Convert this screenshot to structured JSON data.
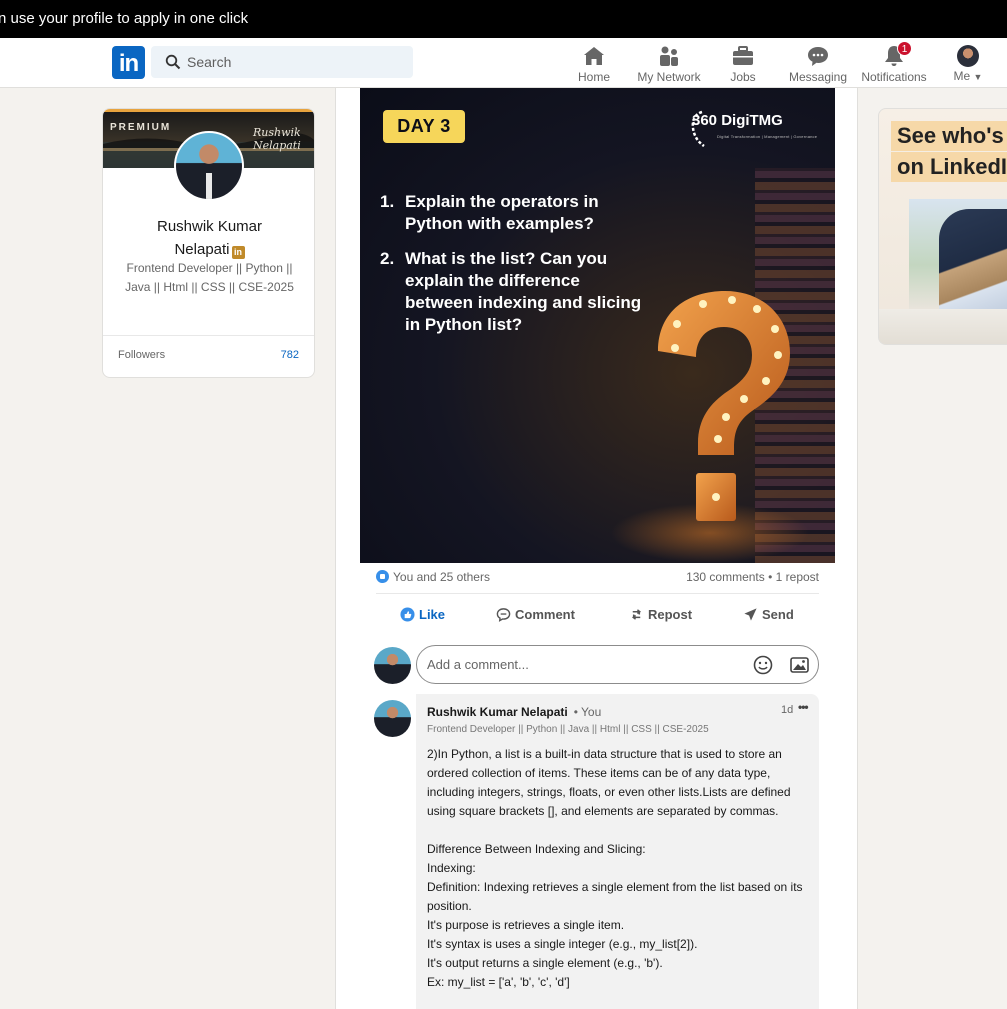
{
  "banner": {
    "text": "n use your profile to apply in one click"
  },
  "nav": {
    "logo": "in",
    "search_placeholder": "Search",
    "items": [
      {
        "label": "Home",
        "icon": "home-icon"
      },
      {
        "label": "My Network",
        "icon": "network-icon"
      },
      {
        "label": "Jobs",
        "icon": "jobs-icon"
      },
      {
        "label": "Messaging",
        "icon": "messaging-icon"
      },
      {
        "label": "Notifications",
        "icon": "bell-icon",
        "badge": "1"
      },
      {
        "label": "Me",
        "icon": "avatar"
      }
    ]
  },
  "profile": {
    "premium": "PREMIUM",
    "cover_signature": "Rushwik Nelapati",
    "name_line1": "Rushwik Kumar",
    "name_line2": "Nelapati",
    "headline": "Frontend Developer || Python || Java || Html || CSS || CSE-2025",
    "followers_label": "Followers",
    "followers_count": "782"
  },
  "post": {
    "image": {
      "day": "DAY 3",
      "brand": "360 DigiTMG",
      "brand_sub": "Digital Transformation | Management | Governance",
      "questions": [
        {
          "num": "1.",
          "text": "Explain the operators in Python with examples?"
        },
        {
          "num": "2.",
          "text": "What is the list? Can you explain the difference between indexing and slicing in Python list?"
        }
      ]
    },
    "reactions_text": "You and 25 others",
    "stats_text": "130 comments • 1 repost",
    "actions": {
      "like": "Like",
      "comment": "Comment",
      "repost": "Repost",
      "send": "Send"
    },
    "comment_placeholder": "Add a comment...",
    "comment": {
      "author": "Rushwik Kumar Nelapati",
      "you": "• You",
      "time": "1d",
      "more": "•••",
      "headline": "Frontend Developer || Python || Java || Html || CSS || CSE-2025",
      "lines": [
        "2)In Python, a list is a built-in data structure that is used to store an ordered collection of items. These items can be of any data type, including integers, strings, floats, or even other lists.Lists are defined using square brackets [], and elements are separated by commas.",
        "",
        "Difference Between Indexing and Slicing:",
        "Indexing:",
        "Definition: Indexing retrieves a single element from the list based on its position.",
        "It's purpose is retrieves a single item.",
        "It's syntax is uses a single integer (e.g., my_list[2]).",
        "It's output returns a single element (e.g., 'b').",
        "Ex: my_list = ['a', 'b', 'c', 'd']"
      ]
    }
  },
  "ad": {
    "line1": "See who's h",
    "line2": "on LinkedIn"
  },
  "colors": {
    "brand": "#0a66c2",
    "premium": "#e7a33e",
    "badge": "#cb112d",
    "day_badge": "#f6d65a"
  }
}
